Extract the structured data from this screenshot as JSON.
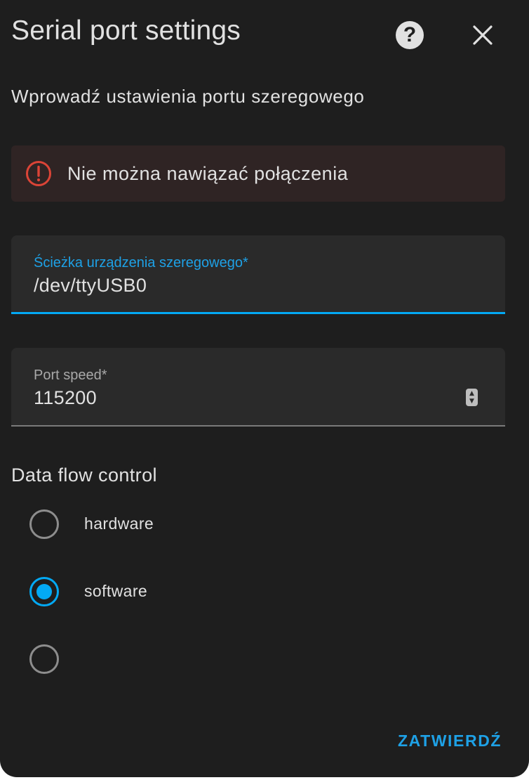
{
  "dialog": {
    "title": "Serial port settings",
    "help_icon": "help-circle-icon",
    "close_icon": "close-icon",
    "description": "Wprowadź ustawienia portu szeregowego"
  },
  "alert": {
    "type": "error",
    "icon": "alert-circle-icon",
    "text": "Nie można nawiązać połączenia",
    "color": "#db4437"
  },
  "fields": {
    "device_path": {
      "label": "Ścieżka urządzenia szeregowego*",
      "value": "/dev/ttyUSB0",
      "focused": true
    },
    "port_speed": {
      "label": "Port speed*",
      "value": "115200",
      "spinner_icon": "number-spinner-icon"
    }
  },
  "flow_control": {
    "title": "Data flow control",
    "options": [
      {
        "label": "hardware",
        "checked": false
      },
      {
        "label": "software",
        "checked": true
      },
      {
        "label": "",
        "checked": false
      }
    ]
  },
  "actions": {
    "submit_label": "ZATWIERDŹ"
  },
  "colors": {
    "background": "#1e1e1e",
    "accent": "#03a9f4",
    "field_background": "#2a2a2a",
    "alert_background": "#2f2424",
    "text": "#e1e1e1"
  }
}
